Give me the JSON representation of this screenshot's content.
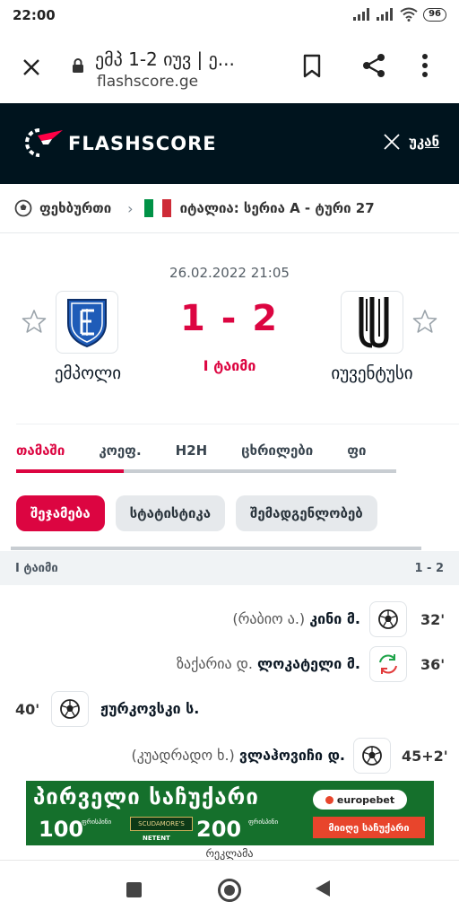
{
  "status_bar": {
    "time": "22:00",
    "battery": "96"
  },
  "browser": {
    "tab_title": "ემპ 1-2 იუვ | ე...",
    "url": "flashscore.ge"
  },
  "header": {
    "brand": "FLASHSCORE",
    "close_label": "უკან"
  },
  "breadcrumb": {
    "sport": "ფეხბურთი",
    "league": "იტალია: სერია A - ტური 27",
    "flag_colors": [
      "#009246",
      "#ffffff",
      "#ce2b37"
    ]
  },
  "match": {
    "datetime": "26.02.2022 21:05",
    "home_team": "ემპოლი",
    "away_team": "იუვენტუსი",
    "score": "1 - 2",
    "status": "I ტაიმი"
  },
  "tabs": [
    "თამაში",
    "კოეფ.",
    "H2H",
    "ცხრილები",
    "ფი"
  ],
  "pills": [
    "შეჯამება",
    "სტატისტიკა",
    "შემადგენლობებ"
  ],
  "period": {
    "label": "I ტაიმი",
    "score": "1 - 2"
  },
  "events": [
    {
      "minute": "32'",
      "side": "away",
      "type": "goal",
      "player": "კინი მ.",
      "assist": "(რაბიო ა.)"
    },
    {
      "minute": "36'",
      "side": "away",
      "type": "substitution",
      "player": "ლოკატელი მ.",
      "assist": "ზაქარია დ."
    },
    {
      "minute": "40'",
      "side": "home",
      "type": "goal",
      "player": "ჟურკოვსკი ს.",
      "assist": ""
    },
    {
      "minute": "45+2'",
      "side": "away",
      "type": "goal",
      "player": "ვლაჰოვიჩი დ.",
      "assist": "(კუადრადო ხ.)"
    }
  ],
  "ad": {
    "headline": "პირველი საჩუქარი",
    "amount1": "100",
    "amount1_text": "ფრისპინი",
    "sponsor": "SCUDAMORE'S",
    "provider": "NETENT",
    "amount2": "200",
    "amount2_text": "ფრისპინი",
    "brand": "europebet",
    "cta": "მიიღე საჩუქარი",
    "label": "რეკლამა"
  },
  "colors": {
    "accent": "#dc0541",
    "header_bg": "#00141e",
    "ad_bg": "#15702c"
  }
}
